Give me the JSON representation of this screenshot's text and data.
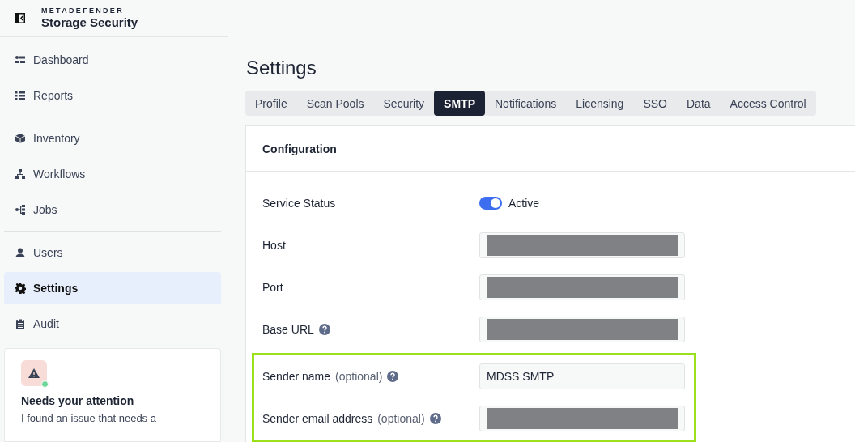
{
  "brand": {
    "overline": "METADEFENDER",
    "title": "Storage Security"
  },
  "sidebar": {
    "groups": [
      [
        {
          "label": "Dashboard",
          "selected": false
        },
        {
          "label": "Reports",
          "selected": false
        }
      ],
      [
        {
          "label": "Inventory",
          "selected": false
        },
        {
          "label": "Workflows",
          "selected": false
        },
        {
          "label": "Jobs",
          "selected": false
        }
      ],
      [
        {
          "label": "Users",
          "selected": false
        },
        {
          "label": "Settings",
          "selected": true
        },
        {
          "label": "Audit",
          "selected": false
        }
      ]
    ],
    "alert": {
      "title": "Needs your attention",
      "text": "I found an issue that needs a"
    }
  },
  "page": {
    "title": "Settings"
  },
  "tabs": [
    {
      "label": "Profile",
      "selected": false
    },
    {
      "label": "Scan Pools",
      "selected": false
    },
    {
      "label": "Security",
      "selected": false
    },
    {
      "label": "SMTP",
      "selected": true
    },
    {
      "label": "Notifications",
      "selected": false
    },
    {
      "label": "Licensing",
      "selected": false
    },
    {
      "label": "SSO",
      "selected": false
    },
    {
      "label": "Data",
      "selected": false
    },
    {
      "label": "Access Control",
      "selected": false
    }
  ],
  "card": {
    "title": "Configuration",
    "fields": [
      {
        "kind": "toggle",
        "label": "Service Status",
        "on": true,
        "value": "Active"
      },
      {
        "kind": "input",
        "label": "Host",
        "redacted": true
      },
      {
        "kind": "input",
        "label": "Port",
        "redacted": true
      },
      {
        "kind": "input",
        "label": "Base URL",
        "redacted": true,
        "help": true
      },
      {
        "kind": "input",
        "label": "Sender name",
        "note": "(optional)",
        "value": "MDSS SMTP",
        "help": true,
        "highlighted": true
      },
      {
        "kind": "input",
        "label": "Sender email address",
        "note": "(optional)",
        "redacted": true,
        "help": true,
        "highlighted": true
      }
    ]
  }
}
